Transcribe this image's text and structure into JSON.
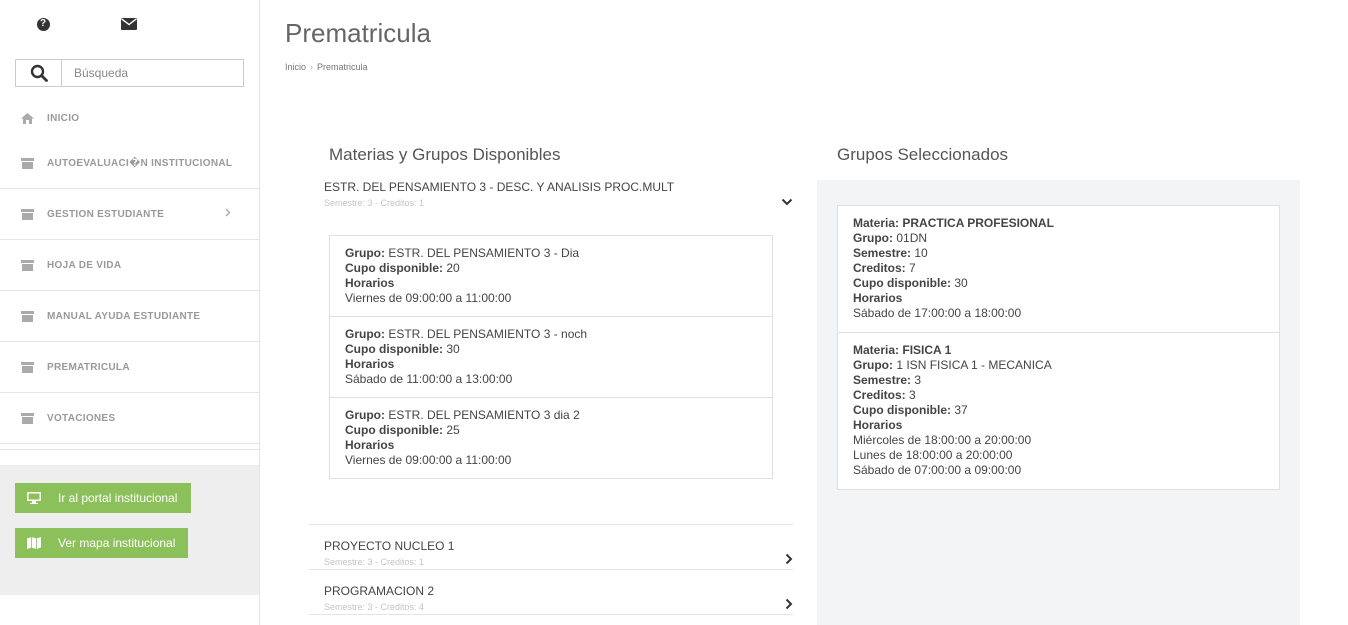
{
  "sidebar": {
    "search_placeholder": "Búsqueda",
    "nav": [
      {
        "label": "INICIO",
        "icon": "home-icon"
      },
      {
        "label": "AUTOEVALUACI�N INSTITUCIONAL",
        "icon": "archive-icon"
      },
      {
        "label": "GESTION ESTUDIANTE",
        "icon": "archive-icon",
        "has_submenu": true
      },
      {
        "label": "HOJA DE VIDA",
        "icon": "archive-icon"
      },
      {
        "label": "MANUAL AYUDA ESTUDIANTE",
        "icon": "archive-icon"
      },
      {
        "label": "PREMATRICULA",
        "icon": "archive-icon"
      },
      {
        "label": "VOTACIONES",
        "icon": "archive-icon"
      }
    ],
    "portal_button": "Ir al portal institucional",
    "map_button": "Ver mapa institucional"
  },
  "page": {
    "title": "Prematricula",
    "breadcrumb": [
      "Inicio",
      "Prematricula"
    ],
    "available_title": "Materias y Grupos Disponibles",
    "selected_title": "Grupos Seleccionados"
  },
  "labels": {
    "grupo": "Grupo:",
    "cupo": "Cupo disponible:",
    "horarios": "Horarios",
    "materia": "Materia:",
    "semestre": "Semestre:",
    "creditos": "Creditos:"
  },
  "subjects": [
    {
      "name": "ESTR. DEL PENSAMIENTO 3 - DESC. Y ANALISIS PROC.MULT",
      "meta": "Semestre: 3 - Creditos: 1",
      "expanded": true,
      "groups": [
        {
          "grupo": "ESTR. DEL PENSAMIENTO 3 - Dia",
          "cupo": "20",
          "horario": "Viernes de 09:00:00 a 11:00:00"
        },
        {
          "grupo": "ESTR. DEL PENSAMIENTO 3 - noch",
          "cupo": "30",
          "horario": "Sábado de 11:00:00 a 13:00:00"
        },
        {
          "grupo": "ESTR. DEL PENSAMIENTO 3 dia 2",
          "cupo": "25",
          "horario": "Viernes de 09:00:00 a 11:00:00"
        }
      ]
    },
    {
      "name": "PROYECTO NUCLEO 1",
      "meta": "Semestre: 3 - Creditos: 1",
      "expanded": false
    },
    {
      "name": "PROGRAMACION 2",
      "meta": "Semestre: 3 - Creditos: 4",
      "expanded": false
    }
  ],
  "selected": [
    {
      "materia": "PRACTICA PROFESIONAL",
      "grupo": "01DN",
      "semestre": "10",
      "creditos": "7",
      "cupo": "30",
      "horarios": [
        "Sábado de 17:00:00 a 18:00:00"
      ]
    },
    {
      "materia": "FISICA 1",
      "grupo": "1 ISN FISICA 1 - MECANICA",
      "semestre": "3",
      "creditos": "3",
      "cupo": "37",
      "horarios": [
        "Miércoles de 18:00:00 a 20:00:00",
        "Lunes de 18:00:00 a 20:00:00",
        "Sábado de 07:00:00 a 09:00:00"
      ]
    }
  ]
}
